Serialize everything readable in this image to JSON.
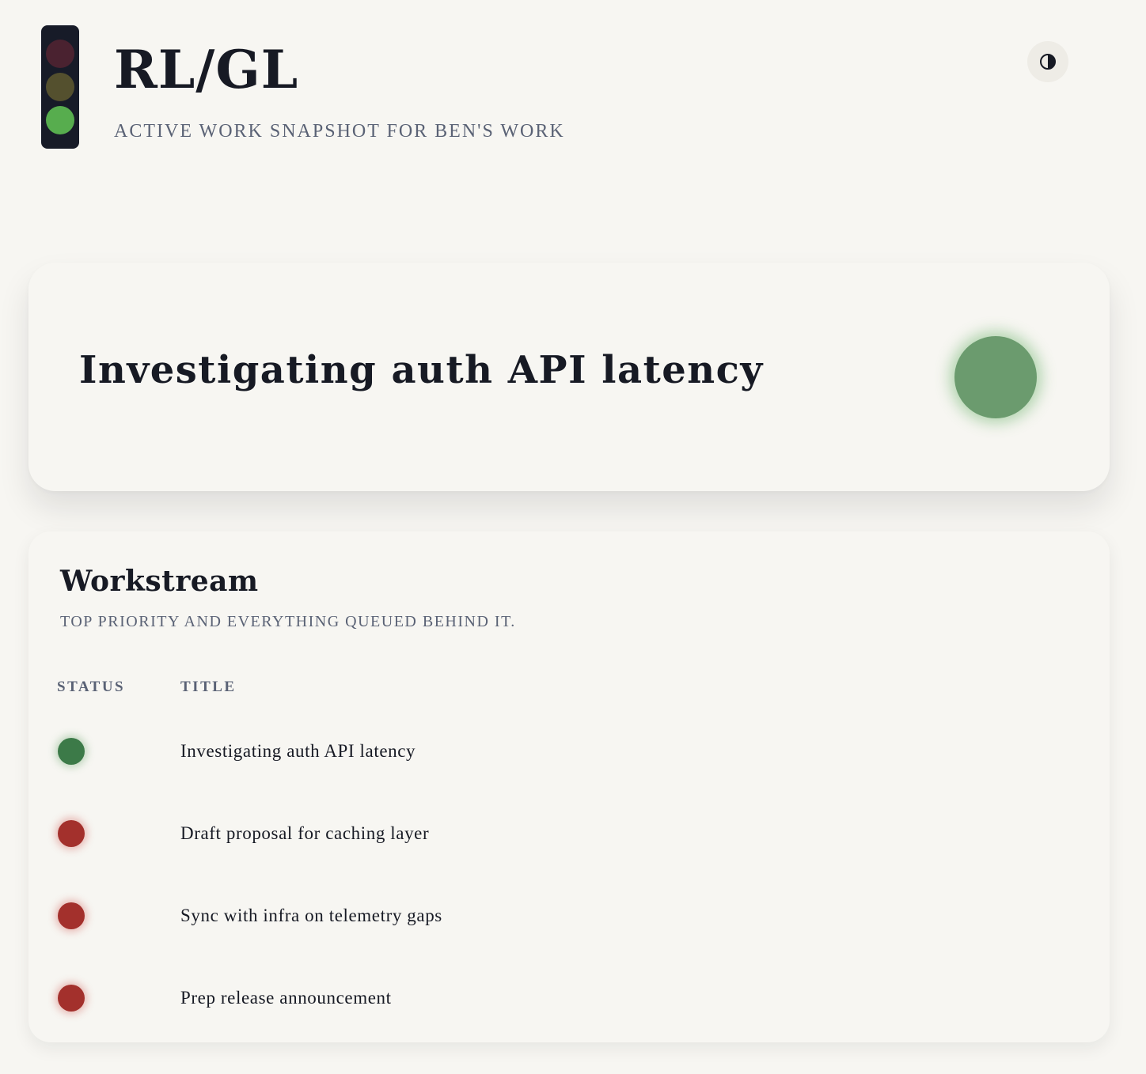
{
  "header": {
    "title": "RL/GL",
    "subtitle": "ACTIVE WORK SNAPSHOT FOR BEN'S WORK",
    "traffic_light": {
      "active": "green",
      "lamps": {
        "red": "#4a2230",
        "yellow": "#54502e",
        "green": "#57ad4e"
      }
    },
    "theme_toggle": {
      "icon": "half-circle-contrast-icon",
      "glyph": "◑"
    }
  },
  "hero": {
    "title": "Investigating auth API latency",
    "status": "green",
    "status_color": "#6b9b6e"
  },
  "workstream": {
    "title": "Workstream",
    "subtitle": "TOP PRIORITY AND EVERYTHING QUEUED BEHIND IT.",
    "columns": {
      "status": "STATUS",
      "title": "TITLE"
    },
    "items": [
      {
        "status": "green",
        "color": "#3c7a48",
        "title": "Investigating auth API latency"
      },
      {
        "status": "red",
        "color": "#a3302c",
        "title": "Draft proposal for caching layer"
      },
      {
        "status": "red",
        "color": "#a3302c",
        "title": "Sync with infra on telemetry gaps"
      },
      {
        "status": "red",
        "color": "#a3302c",
        "title": "Prep release announcement"
      }
    ]
  },
  "colors": {
    "background": "#f7f6f2",
    "text": "#171a24",
    "muted": "#5a6275",
    "traffic_light_body": "#171b28"
  }
}
